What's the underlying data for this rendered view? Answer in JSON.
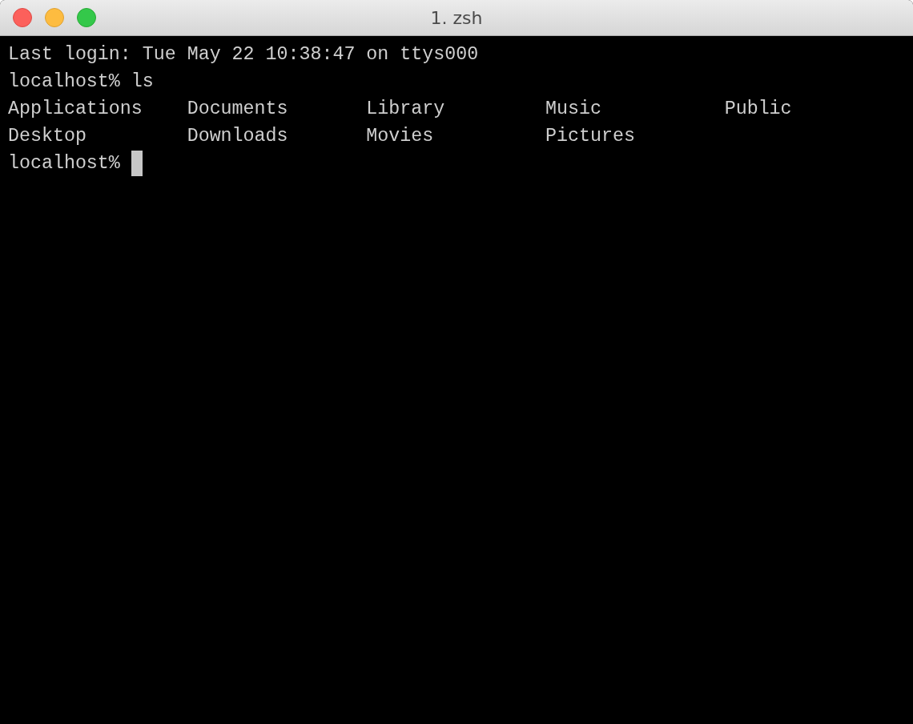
{
  "window": {
    "title": "1. zsh"
  },
  "terminal": {
    "lines": [
      {
        "kind": "text",
        "text": "Last login: Tue May 22 10:38:47 on ttys000"
      },
      {
        "kind": "prompt",
        "text": "localhost% ls",
        "cursor": false
      },
      {
        "kind": "columns",
        "items": [
          "Applications",
          "Documents",
          "Library",
          "Music",
          "Public"
        ]
      },
      {
        "kind": "columns",
        "items": [
          "Desktop",
          "Downloads",
          "Movies",
          "Pictures"
        ]
      },
      {
        "kind": "prompt",
        "text": "localhost%",
        "cursor": true
      }
    ]
  }
}
